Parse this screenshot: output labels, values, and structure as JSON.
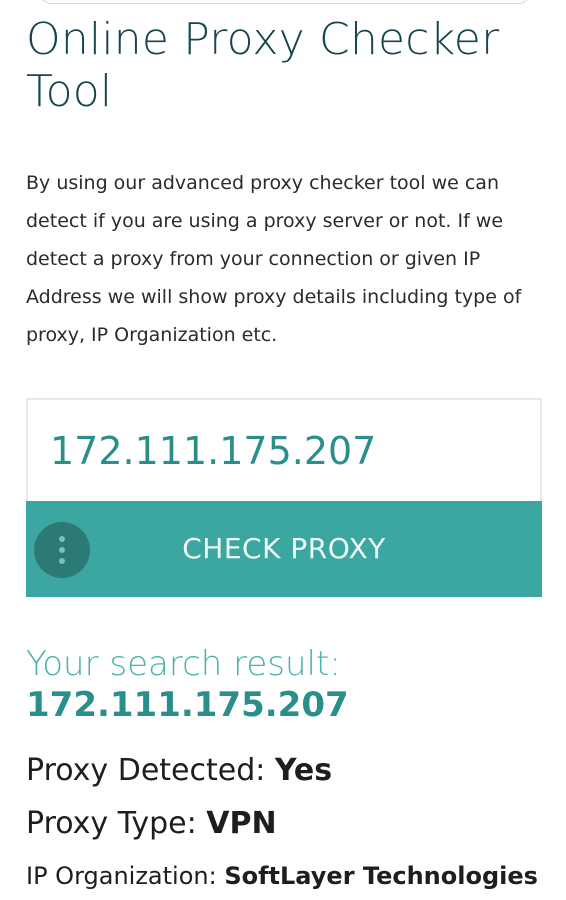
{
  "page": {
    "title": "Online Proxy Checker Tool",
    "description": "By using our advanced proxy checker tool we can detect if you are using a proxy server or not. If we detect a proxy from your connection or given IP Address we will show proxy details including type of proxy, IP Organization etc."
  },
  "form": {
    "ip_value": "172.111.175.207",
    "check_button_label": "CHECK PROXY",
    "more_icon": "vertical-ellipsis-icon"
  },
  "result": {
    "heading": "Your search result:",
    "ip": "172.111.175.207",
    "proxy_detected_label": "Proxy Detected: ",
    "proxy_detected_value": "Yes",
    "proxy_type_label": "Proxy Type: ",
    "proxy_type_value": "VPN",
    "ip_org_label": "IP Organization: ",
    "ip_org_value": "SoftLayer Technologies"
  },
  "colors": {
    "title": "#16454d",
    "accent": "#3ca7a0",
    "accent_dark": "#2a8f8a",
    "result_heading": "#49b3ac"
  }
}
